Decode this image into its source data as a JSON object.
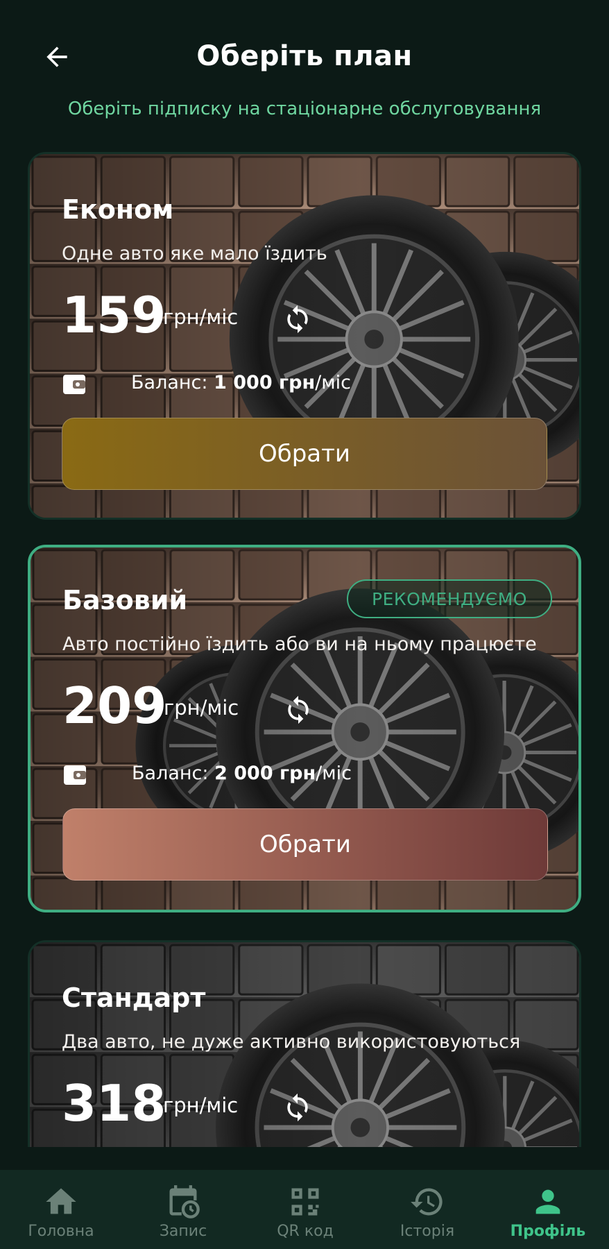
{
  "header": {
    "title": "Оберіть план",
    "subtitle": "Оберіть підписку на стаціонарне обслуговування"
  },
  "plans": [
    {
      "name": "Економ",
      "description": "Одне авто яке мало їздить",
      "price": "159",
      "unit": "грн/міс",
      "balance_label": "Баланс:",
      "balance_amount": "1 000 грн",
      "balance_suffix": "/міс",
      "button": "Обрати",
      "button_gradient": [
        "#8a6a14",
        "#6b5238"
      ]
    },
    {
      "name": "Базовий",
      "badge": "РЕКОМЕНДУЄМО",
      "description": "Авто постійно їздить або ви на ньому працюєте",
      "price": "209",
      "unit": "грн/міс",
      "balance_label": "Баланс:",
      "balance_amount": "2 000 грн",
      "balance_suffix": "/міс",
      "button": "Обрати",
      "button_gradient": [
        "#c0806a",
        "#6e3a38"
      ]
    },
    {
      "name": "Стандарт",
      "description": "Два авто, не дуже активно використовуються",
      "price": "318",
      "unit": "грн/міс"
    }
  ],
  "nav": {
    "items": [
      {
        "label": "Головна",
        "icon": "home-icon"
      },
      {
        "label": "Запис",
        "icon": "calendar-icon"
      },
      {
        "label": "QR код",
        "icon": "qr-code-icon"
      },
      {
        "label": "Історія",
        "icon": "history-icon"
      },
      {
        "label": "Профіль",
        "icon": "profile-icon",
        "active": true
      }
    ]
  },
  "colors": {
    "background": "#0c1a16",
    "accent": "#3fae82",
    "subtitle": "#6fd6a0",
    "nav_inactive": "#6b8178",
    "nav_active": "#3fc48a"
  }
}
